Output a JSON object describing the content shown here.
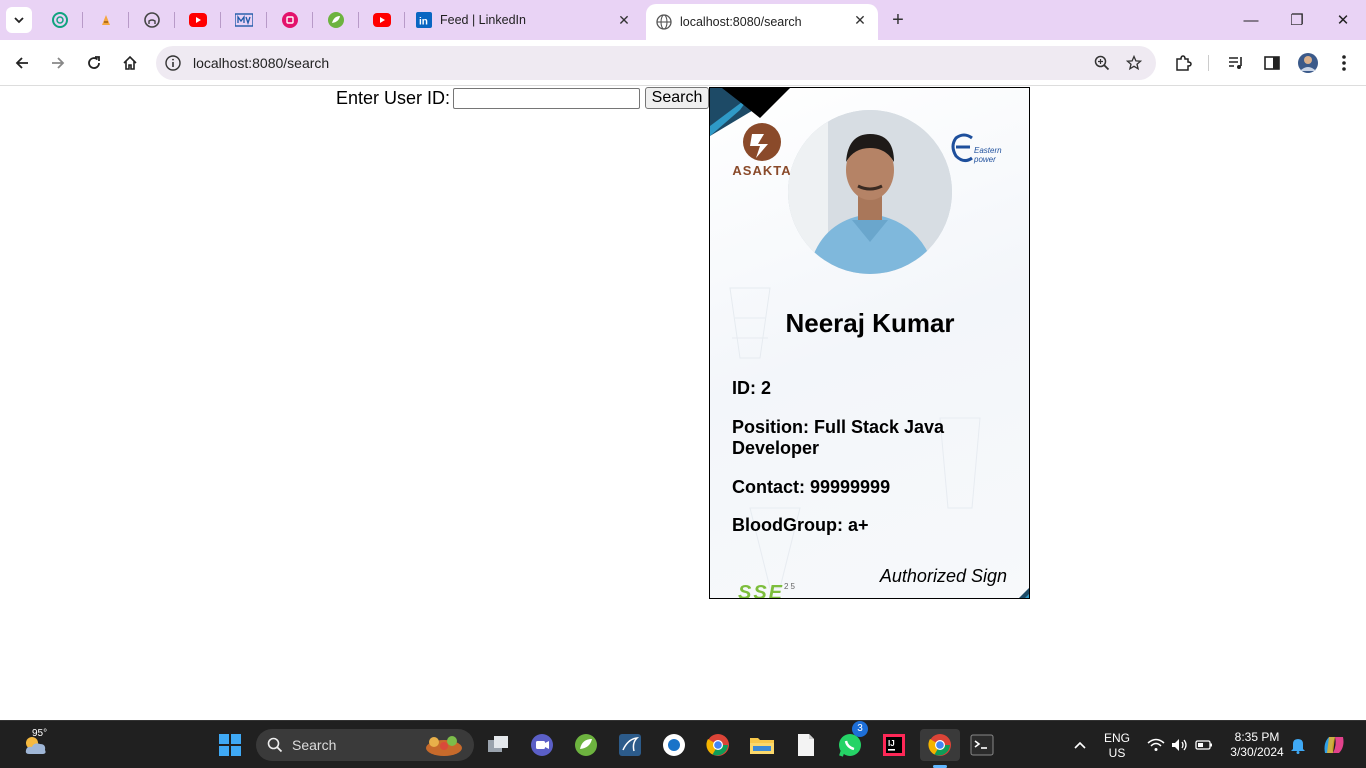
{
  "browser": {
    "tabs": {
      "linkedin_title": "Feed | LinkedIn",
      "active_title": "localhost:8080/search",
      "close_glyph": "✕",
      "new_tab_glyph": "+"
    },
    "window_controls": {
      "minimize": "—",
      "restore": "❐",
      "close": "✕"
    },
    "url": "localhost:8080/search"
  },
  "page": {
    "search": {
      "label": "Enter User ID:",
      "input_value": "",
      "button_label": "Search"
    },
    "card": {
      "left_logo_text": "ASAKTA",
      "right_logo_text": "Eastern power",
      "name": "Neeraj Kumar",
      "id_line": "ID: 2",
      "position_line": "Position: Full Stack Java Developer",
      "contact_line": "Contact: 99999999",
      "blood_line": "BloodGroup: a+",
      "signature": "Authorized Sign",
      "footer_logo_text": "SSE",
      "footer_logo_sup": "25"
    }
  },
  "taskbar": {
    "weather_temp": "95°",
    "search_label": "Search",
    "whatsapp_badge": "3",
    "lang_top": "ENG",
    "lang_bottom": "US",
    "time": "8:35 PM",
    "date": "3/30/2024"
  }
}
